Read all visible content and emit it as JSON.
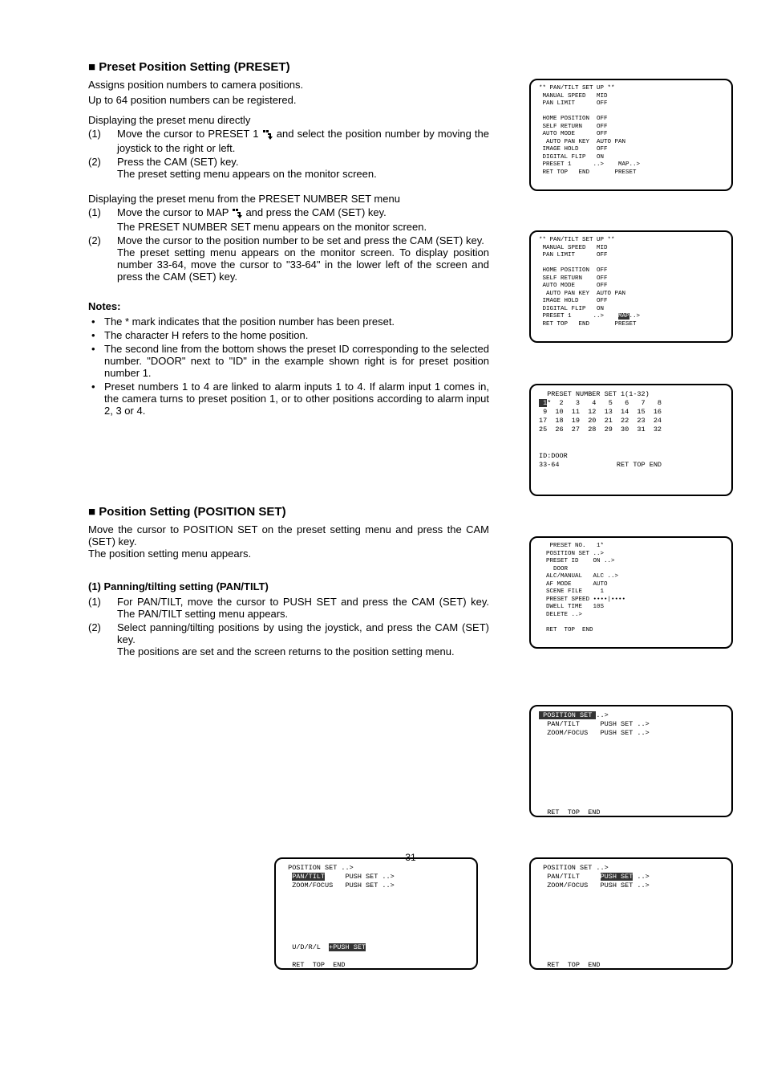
{
  "h1": "■ Preset Position Setting (PRESET)",
  "h1s": "Assigns position numbers to camera positions.",
  "h1note": "Up to 64 position numbers can be registered.",
  "sub_direct": "Displaying the preset menu directly",
  "direct_steps": {
    "n1": "(1)",
    "t1a": "Move the cursor to PRESET 1 ",
    "t1b": " and select the position number by moving the joystick to the right or left.",
    "n2": "(2)",
    "t2": "Press the CAM (SET) key.\nThe preset setting menu appears on the monitor screen."
  },
  "sub_from": "Displaying the preset menu from the PRESET NUMBER SET menu",
  "from_steps": {
    "n1": "(1)",
    "t1a": "Move the cursor to MAP ",
    "t1b": " and press the CAM (SET) key.\nThe PRESET NUMBER SET menu appears on the monitor screen.",
    "n2": "(2)",
    "t2": "Move the cursor to the position number to be set and press the CAM (SET) key.\nThe preset setting menu appears on the monitor screen. To display position number 33-64, move the cursor to \"33-64\" in the lower left of the screen and press the CAM (SET) key."
  },
  "notes_head": "Notes:",
  "notes": [
    "The * mark indicates that the position number has been preset.",
    "The character H refers to the home position.",
    "The second line from the bottom shows the preset ID corresponding to the selected number. \"DOOR\" next to \"ID\" in the example shown right is for preset position number 1.",
    "Preset numbers 1 to 4 are linked to alarm inputs 1 to 4. If alarm input 1 comes in, the camera turns to preset position 1, or to other positions according to alarm input 2, 3 or 4."
  ],
  "h2": "■ Position Setting (POSITION SET)",
  "pos_para": "Move the cursor to POSITION SET on the preset setting menu and press the CAM (SET) key.\nThe position setting menu appears.",
  "h3": "(1) Panning/tilting setting (PAN/TILT)",
  "pt_steps": {
    "n1": "(1)",
    "t1": "For PAN/TILT, move the cursor to PUSH SET and press the CAM (SET) key. The PAN/TILT setting menu appears.",
    "n2": "(2)",
    "t2": "Select panning/tilting positions by using the joystick, and press the CAM (SET) key.\nThe positions are set and the screen returns to the position setting menu."
  },
  "monitors": {
    "m1": "** PAN/TILT SET UP **\n MANUAL SPEED   MID\n PAN LIMIT      OFF\n\n HOME POSITION  OFF\n SELF RETURN    OFF\n AUTO MODE      OFF\n  AUTO PAN KEY  AUTO PAN\n IMAGE HOLD     OFF\n DIGITAL FLIP   ON\n PRESET 1      ..>    MAP..>\n RET TOP   END       PRESET",
    "m1_hl_pre": " PRESET ",
    "m1_hl_hl": "1",
    "m1_hl_post": "      ..>    MAP..>",
    "m2": "** PAN/TILT SET UP **\n MANUAL SPEED   MID\n PAN LIMIT      OFF\n\n HOME POSITION  OFF\n SELF RETURN    OFF\n AUTO MODE      OFF\n  AUTO PAN KEY  AUTO PAN\n IMAGE HOLD     OFF\n DIGITAL FLIP   ON\n PRESET 1      ..>    ",
    "m2_hl": "MAP",
    "m2_post": "..>\n RET TOP   END       PRESET",
    "m3_title": "  PRESET NUMBER SET 1(1-32)",
    "m3_body": " 1*  2   3   4   5   6   7   8\n 9  10  11  12  13  14  15  16\n17  18  19  20  21  22  23  24\n25  26  27  28  29  30  31  32\n\n\nID:DOOR\n33-64              RET TOP END",
    "m3_hl": " 1",
    "m4": "   PRESET NO.   1*\n  POSITION SET ..>\n  PRESET ID    ON ..>\n    DOOR\n  ALC/MANUAL   ALC ..>\n  AF MODE      AUTO\n  SCENE FILE     1\n  PRESET SPEED ••••|••••\n  DWELL TIME   10S\n  DELETE ..>\n\n  RET  TOP  END",
    "m5_hl": " POSITION SET ",
    "m5_body": "..>\n  PAN/TILT     PUSH SET ..>\n  ZOOM/FOCUS   PUSH SET ..>\n\n\n\n\n\n\n\n\n  RET  TOP  END",
    "m6_pre": " POSITION SET ..>\n  ",
    "m6_hl": "PAN/TILT",
    "m6_post": "     PUSH SET ..>\n  ZOOM/FOCUS   PUSH SET ..>\n\n\n\n\n\n\n  U/D/R/L  ",
    "m6_hl2": "+PUSH SET",
    "m6_end": "\n\n  RET  TOP  END",
    "m7_pre": " POSITION SET ..>\n  PAN/TILT     ",
    "m7_hl": "PUSH SET",
    "m7_post": " ..>\n  ZOOM/FOCUS   PUSH SET ..>\n\n\n\n\n\n\n\n\n  RET  TOP  END"
  },
  "pagenum": "-31-"
}
